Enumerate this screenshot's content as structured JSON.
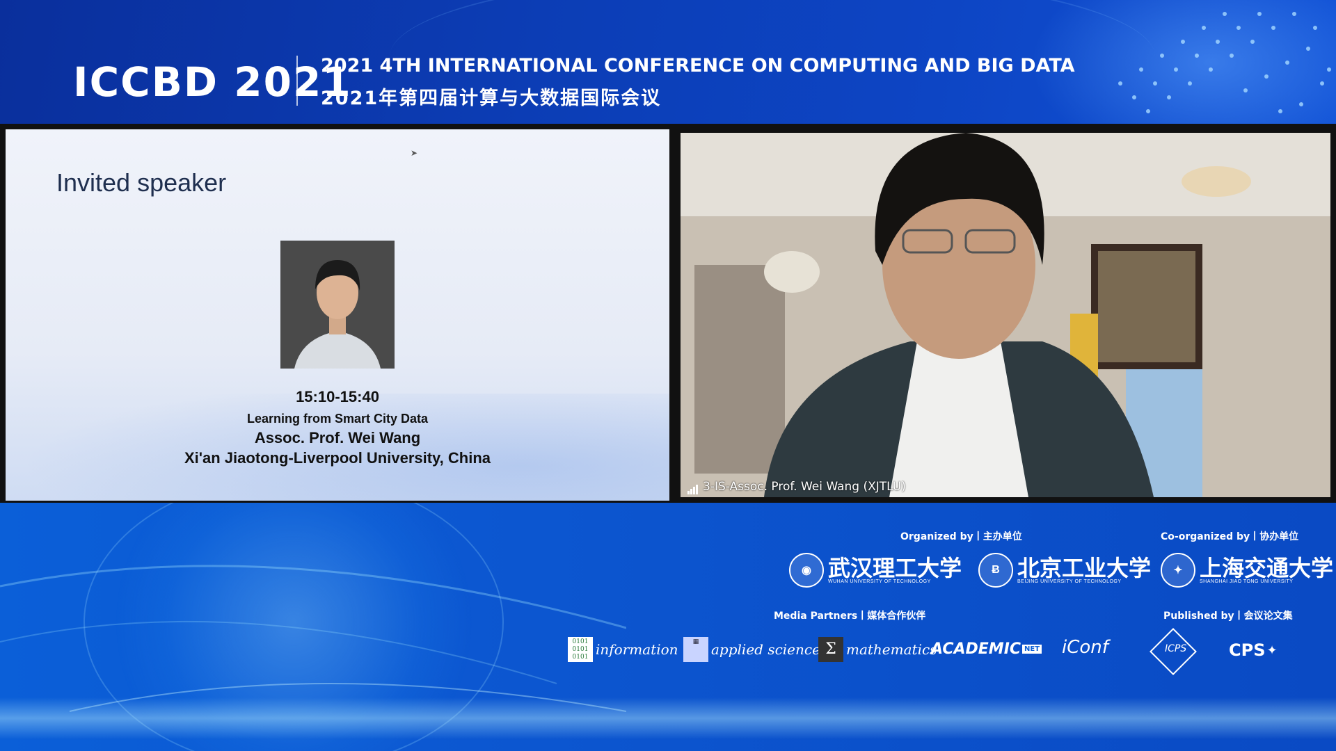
{
  "header": {
    "logo": "ICCBD 2021",
    "title_en": "2021 4TH INTERNATIONAL CONFERENCE ON COMPUTING AND BIG DATA",
    "title_cn": "2021年第四届计算与大数据国际会议"
  },
  "slide": {
    "heading": "Invited speaker",
    "time": "15:10-15:40",
    "talk": "Learning from Smart City Data",
    "speaker": "Assoc. Prof. Wei Wang",
    "affiliation": "Xi'an Jiaotong-Liverpool University, China"
  },
  "video": {
    "participant_label": "3-IS-Assoc. Prof. Wei Wang (XJTLU)",
    "signal_icon": "signal-bars-icon"
  },
  "footer": {
    "organized_label": "Organized by丨主办单位",
    "coorganized_label": "Co-organized by丨协办单位",
    "media_label": "Media Partners丨媒体合作伙伴",
    "published_label": "Published by丨会议论文集",
    "organizers": [
      {
        "name": "武汉理工大学",
        "sub": "WUHAN UNIVERSITY OF TECHNOLOGY"
      },
      {
        "name": "北京工业大学",
        "sub": "BEIJING UNIVERSITY OF TECHNOLOGY"
      }
    ],
    "coorganizer": {
      "name": "上海交通大学",
      "sub": "SHANGHAI JIAO TONG UNIVERSITY"
    },
    "media": [
      "information",
      "applied sciences",
      "mathematics",
      "ACADEMIC",
      "iConf"
    ],
    "publishers": [
      "ICPS",
      "CPS"
    ]
  },
  "colors": {
    "header_bg": "#0c3db5",
    "footer_bg": "#0b5fd8",
    "slide_bg": "#eef2f9"
  }
}
